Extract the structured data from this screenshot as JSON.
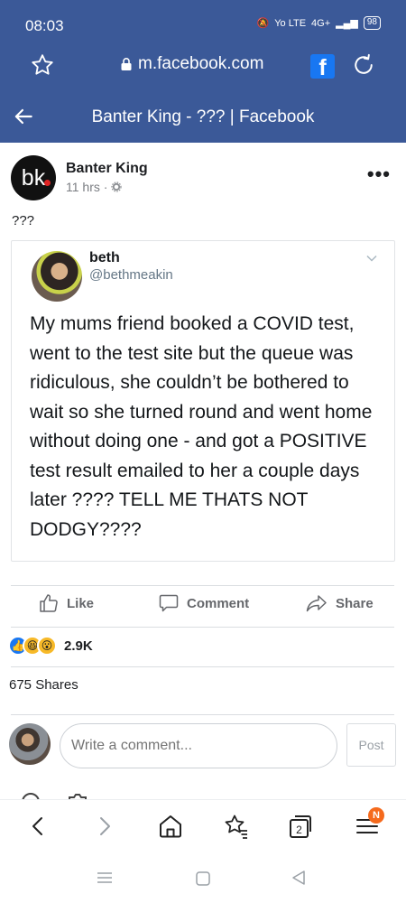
{
  "status": {
    "time": "08:03",
    "network": "4G+",
    "volte": "Yo LTE",
    "battery": "98"
  },
  "browser": {
    "url": "m.facebook.com",
    "page_title": "Banter King - ??? | Facebook",
    "tab_count": "2",
    "menu_badge": "N"
  },
  "post": {
    "avatar_text": "bk",
    "author": "Banter King",
    "time": "11 hrs ·",
    "caption": "???",
    "tweet": {
      "name": "beth",
      "handle": "@bethmeakin",
      "text": "My mums friend booked a COVID test, went to the test site but the queue was ridiculous, she couldn’t be bothered to wait so she turned round and went home without doing one - and got a POSITIVE test result emailed to her a couple days later ???? TELL ME THATS NOT DODGY????"
    },
    "actions": {
      "like": "Like",
      "comment": "Comment",
      "share": "Share"
    },
    "reaction_count": "2.9K",
    "shares": "675 Shares"
  },
  "comment": {
    "placeholder": "Write a comment...",
    "post_label": "Post"
  },
  "colors": {
    "brand": "#3b5998",
    "fb_blue": "#1877f2"
  }
}
